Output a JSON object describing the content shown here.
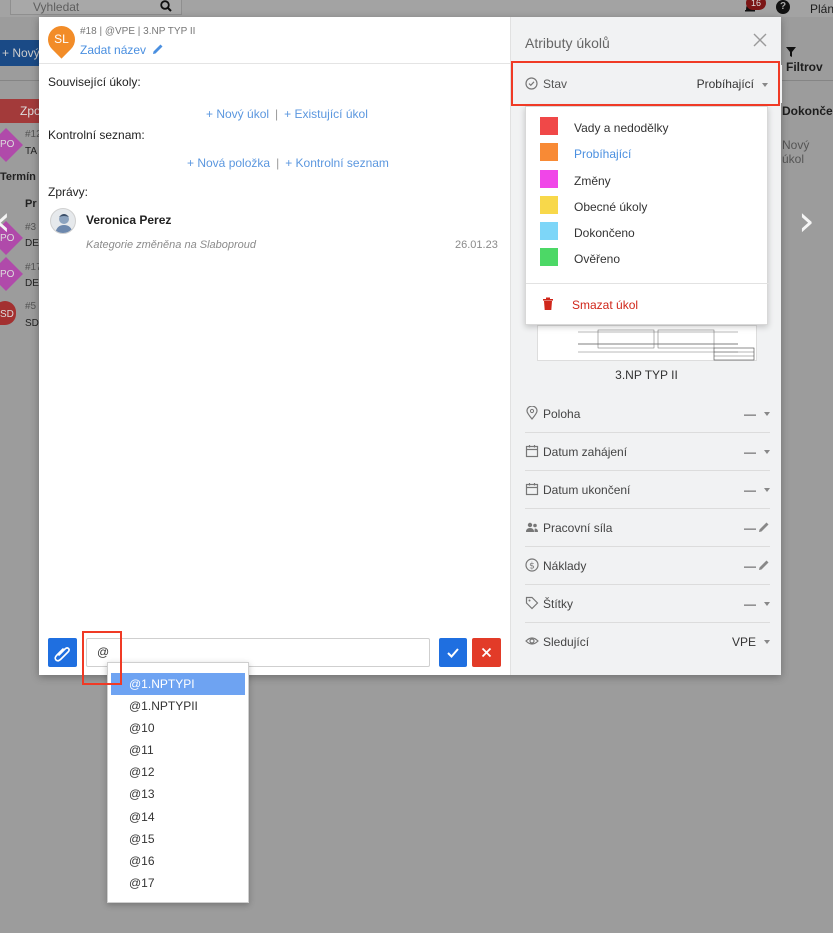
{
  "background": {
    "search_placeholder": "Vyhledat",
    "notification_count": "16",
    "help_label": "?",
    "plan_label": "Plán",
    "new_button": "+ Nový",
    "filter_button": "Filtrov",
    "left_header": "Zpo",
    "left_subheader": "Termín z",
    "right_column_header": "Dokončeno",
    "right_column_cell": "Nový úkol",
    "rows": [
      {
        "badge": "PO",
        "id": "#12",
        "text": "TA"
      },
      {
        "badge": "PO",
        "id": "#3",
        "text": "DE"
      },
      {
        "badge": "PO",
        "id": "#17",
        "text": "DE"
      },
      {
        "badge": "SD",
        "id": "#5",
        "text": "SD"
      }
    ],
    "pr_label": "Pr"
  },
  "task": {
    "avatar_initials": "SL",
    "meta": "#18 | @VPE | 3.NP TYP II",
    "title_placeholder": "Zadat název",
    "related_label": "Související úkoly:",
    "new_task_link": "+ Nový úkol",
    "existing_task_link": "+ Existující úkol",
    "checklist_label": "Kontrolní seznam:",
    "new_item_link": "+ Nová položka",
    "checklist_link": "+ Kontrolní seznam",
    "messages_label": "Zprávy:",
    "messages": [
      {
        "author": "Veronica Perez",
        "text": "Kategorie změněna na Slaboproud",
        "date": "26.01.23"
      }
    ],
    "input_value": "@"
  },
  "attributes": {
    "title": "Atributy úkolů",
    "status_label": "Stav",
    "status_value": "Probíhající",
    "plan_name": "3.NP TYP II",
    "rows": [
      {
        "label": "Poloha",
        "value": "—",
        "icon": "location-icon",
        "control": "caret"
      },
      {
        "label": "Datum zahájení",
        "value": "—",
        "icon": "calendar-icon",
        "control": "caret"
      },
      {
        "label": "Datum ukončení",
        "value": "—",
        "icon": "calendar-icon",
        "control": "caret"
      },
      {
        "label": "Pracovní síla",
        "value": "—",
        "icon": "people-icon",
        "control": "pencil"
      },
      {
        "label": "Náklady",
        "value": "—",
        "icon": "dollar-icon",
        "control": "pencil"
      },
      {
        "label": "Štítky",
        "value": "—",
        "icon": "tag-icon",
        "control": "caret"
      },
      {
        "label": "Sledující",
        "value": "VPE",
        "icon": "eye-icon",
        "control": "caret"
      }
    ]
  },
  "status_menu": {
    "options": [
      {
        "label": "Vady a nedodělky",
        "color": "#f04848"
      },
      {
        "label": "Probíhající",
        "color": "#f88a35",
        "selected": true
      },
      {
        "label": "Změny",
        "color": "#f046e8"
      },
      {
        "label": "Obecné úkoly",
        "color": "#f8d84a"
      },
      {
        "label": "Dokončeno",
        "color": "#7dd6f8"
      },
      {
        "label": "Ověřeno",
        "color": "#4cd866"
      }
    ],
    "delete_label": "Smazat úkol"
  },
  "mention_menu": {
    "options": [
      "@1.NPTYPI",
      "@1.NPTYPII",
      "@10",
      "@11",
      "@12",
      "@13",
      "@14",
      "@15",
      "@16",
      "@17"
    ],
    "active_index": 0
  },
  "colors": {
    "accent": "#1f6fe0",
    "link": "#5b97df",
    "danger": "#e23b28",
    "highlight": "#f03a25",
    "avatar": "#f28c28"
  }
}
